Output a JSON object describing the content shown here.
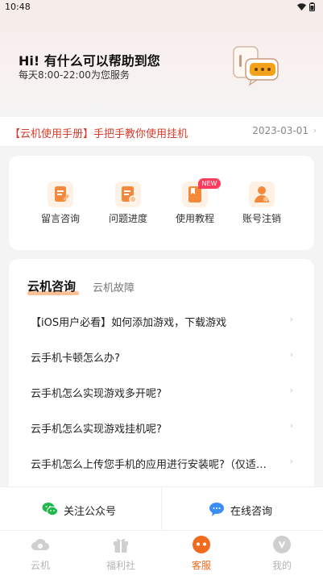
{
  "status": {
    "time": "10:48"
  },
  "hero": {
    "title": "Hi! 有什么可以帮助到您",
    "subtitle": "每天8:00-22:00为您服务",
    "illustration": "chat-bubbles-icon"
  },
  "notice": {
    "text": "【云机使用手册】手把手教你使用挂机",
    "date": "2023-03-01"
  },
  "quick_actions": [
    {
      "label": "留言咨询",
      "icon": "document-edit-icon",
      "badge": ""
    },
    {
      "label": "问题进度",
      "icon": "document-search-icon",
      "badge": ""
    },
    {
      "label": "使用教程",
      "icon": "book-icon",
      "badge": "NEW"
    },
    {
      "label": "账号注销",
      "icon": "user-icon",
      "badge": ""
    }
  ],
  "faq": {
    "tabs": [
      "云机咨询",
      "云机故障"
    ],
    "items": [
      "【iOS用户必看】如何添加游戏，下载游戏",
      "云手机卡顿怎么办?",
      "云手机怎么实现游戏多开呢?",
      "云手机怎么实现游戏挂机呢?",
      "云手机怎么上传您手机的应用进行安装呢?（仅适用于安卓）"
    ]
  },
  "bottom_actions": {
    "follow": "关注公众号",
    "online": "在线咨询"
  },
  "tabbar": {
    "items": [
      "云机",
      "福利社",
      "客服",
      "我的"
    ],
    "active_index": 2
  },
  "colors": {
    "accent": "#f06b1d",
    "notice_red": "#d93a2c",
    "new_badge": "#ff3c5d"
  }
}
